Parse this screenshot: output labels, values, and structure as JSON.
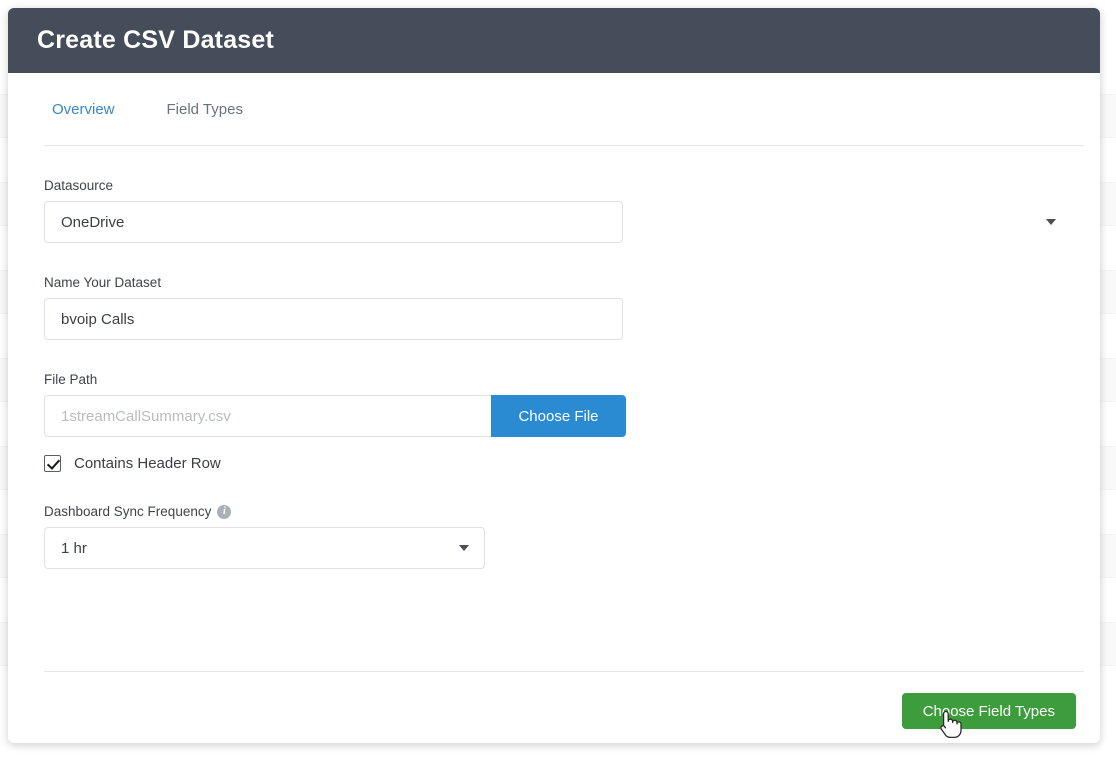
{
  "modal": {
    "title": "Create CSV Dataset",
    "tabs": [
      {
        "label": "Overview",
        "active": true
      },
      {
        "label": "Field Types",
        "active": false
      }
    ],
    "fields": {
      "datasource": {
        "label": "Datasource",
        "value": "OneDrive",
        "control": "select",
        "options": [
          "OneDrive"
        ]
      },
      "dataset_name": {
        "label": "Name Your Dataset",
        "value": "bvoip Calls",
        "placeholder": "",
        "control": "text"
      },
      "file_path": {
        "label": "File Path",
        "value": "",
        "placeholder": "1streamCallSummary.csv",
        "control": "text",
        "button_label": "Choose File"
      },
      "contains_header_row": {
        "label": "Contains Header Row",
        "checked": true,
        "control": "checkbox"
      },
      "sync_frequency": {
        "label": "Dashboard Sync Frequency",
        "value": "1 hr",
        "control": "select",
        "options": [
          "1 hr"
        ],
        "info_glyph": "i"
      }
    },
    "footer": {
      "primary_button": "Choose Field Types"
    }
  },
  "colors": {
    "header_bar": "#454c5a",
    "tab_active": "#3a86c8",
    "choose_file_button": "#2a8bd2",
    "primary_button": "#3d9c3c",
    "placeholder_text": "#b7bcc0"
  },
  "cursor": {
    "type": "pointer-hand"
  }
}
